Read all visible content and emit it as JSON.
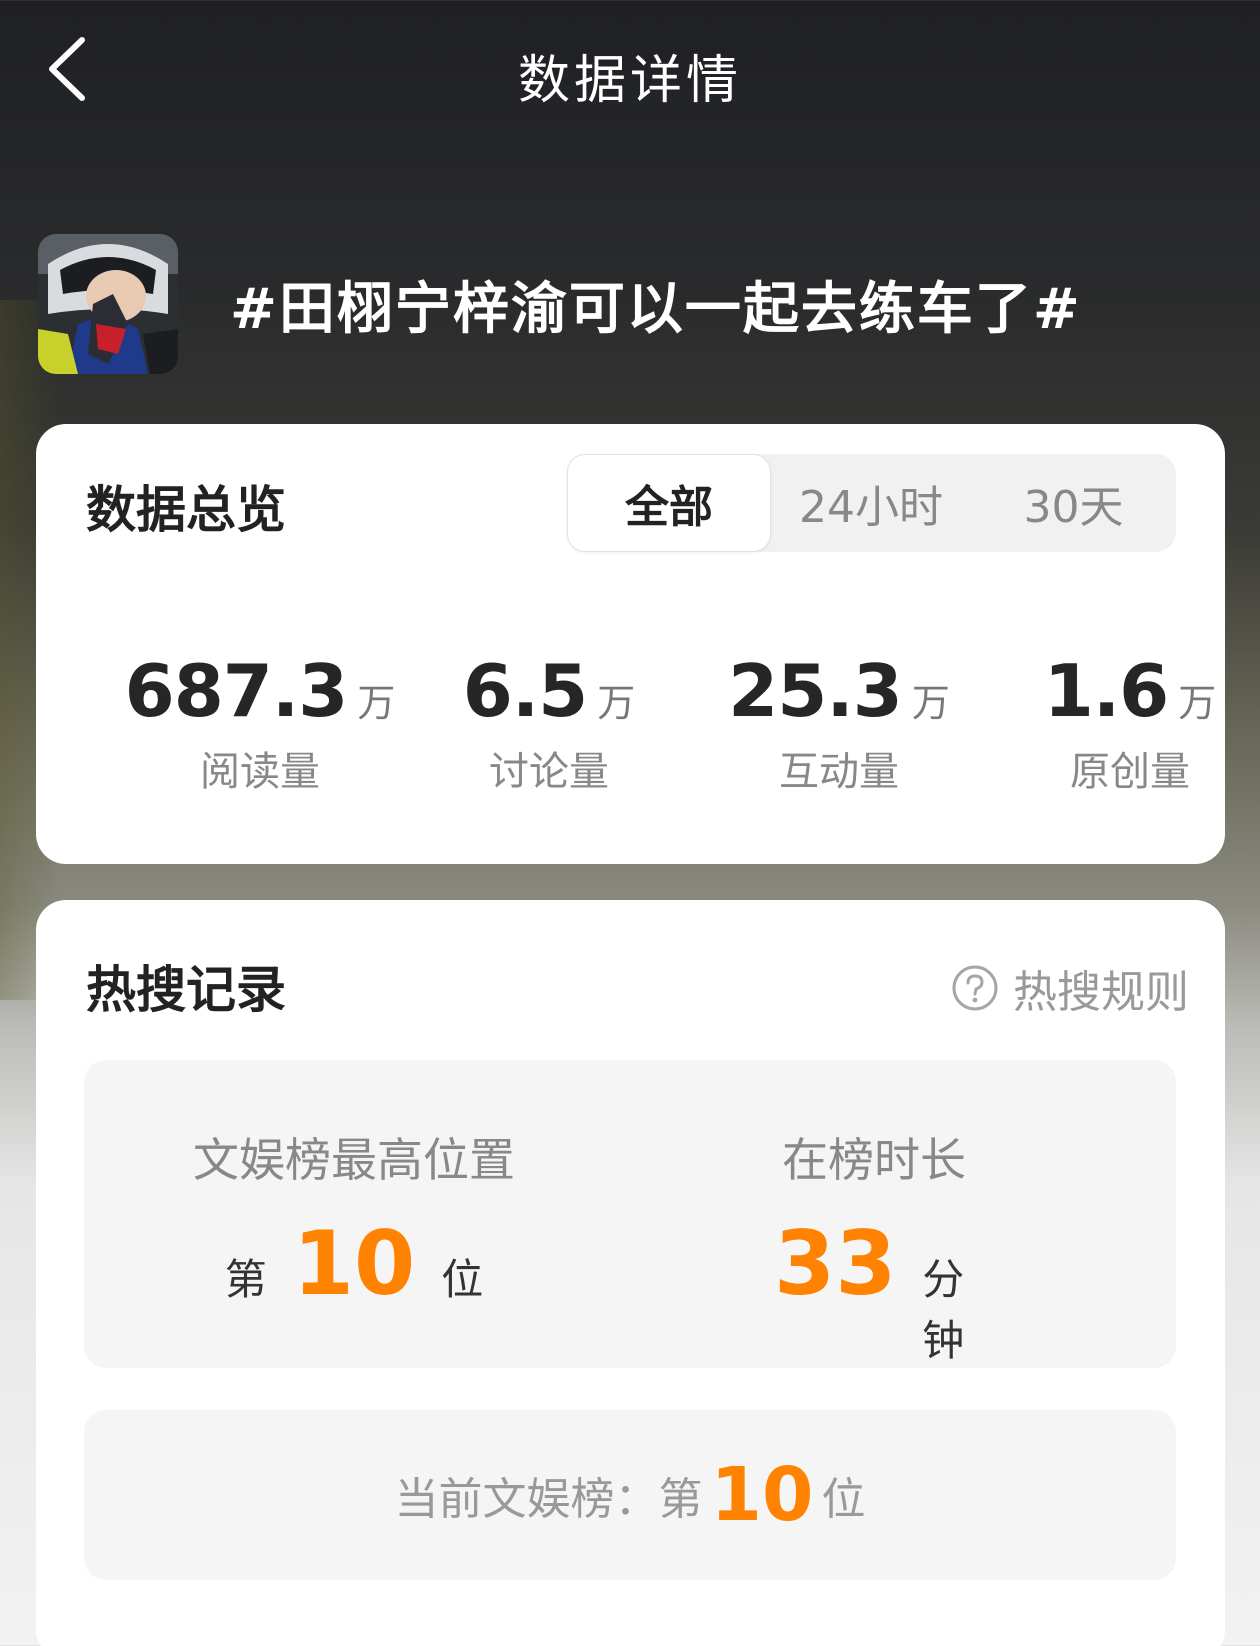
{
  "header": {
    "title": "数据详情"
  },
  "topic": {
    "title": "#田栩宁梓渝可以一起去练车了#"
  },
  "overview": {
    "title": "数据总览",
    "tabs": [
      {
        "label": "全部",
        "active": true
      },
      {
        "label": "24小时",
        "active": false
      },
      {
        "label": "30天",
        "active": false
      }
    ],
    "stats": [
      {
        "value": "687.3",
        "unit": "万",
        "label": "阅读量"
      },
      {
        "value": "6.5",
        "unit": "万",
        "label": "讨论量"
      },
      {
        "value": "25.3",
        "unit": "万",
        "label": "互动量"
      },
      {
        "value": "1.6",
        "unit": "万",
        "label": "原创量"
      }
    ]
  },
  "hot": {
    "title": "热搜记录",
    "rules_label": "热搜规则",
    "highest": {
      "label": "文娱榜最高位置",
      "prefix": "第",
      "value": "10",
      "suffix": "位"
    },
    "duration": {
      "label": "在榜时长",
      "value": "33",
      "suffix": "分钟"
    },
    "current": {
      "label": "当前文娱榜：",
      "prefix": "第",
      "value": "10",
      "suffix": "位"
    }
  },
  "colors": {
    "accent": "#ff8200"
  },
  "icons": {
    "back": "chevron-left-icon",
    "help": "question-circle-icon"
  }
}
